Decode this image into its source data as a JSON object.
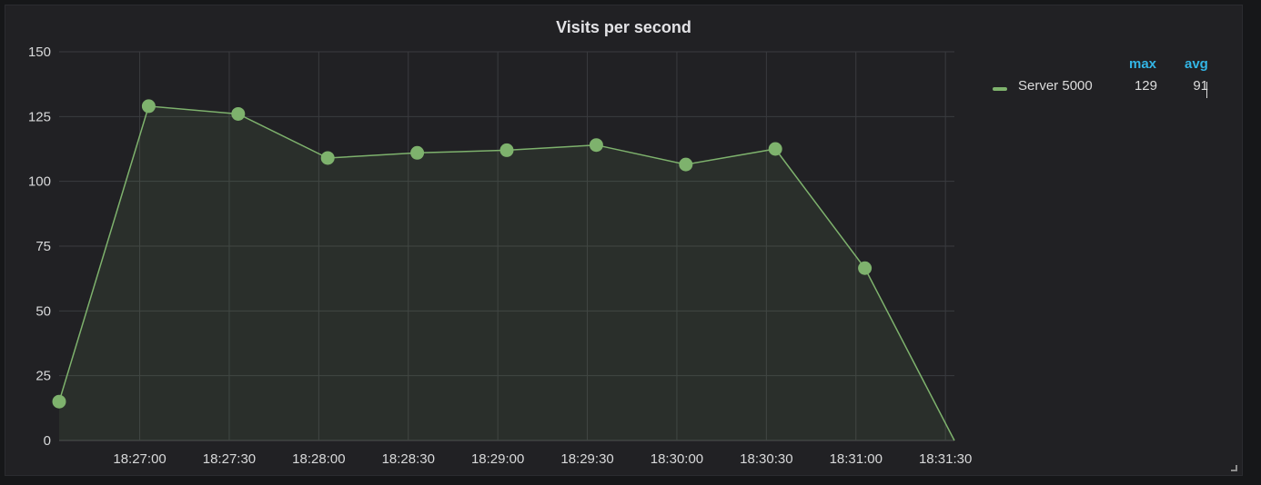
{
  "panel": {
    "title": "Visits per second"
  },
  "legend": {
    "columns": {
      "max": "max",
      "avg": "avg"
    },
    "series": [
      {
        "name": "Server 5000",
        "color": "#7eb26d",
        "max": "129",
        "avg": "91"
      }
    ]
  },
  "chart_data": {
    "type": "area",
    "title": "Visits per second",
    "xlabel": "",
    "ylabel": "",
    "ylim": [
      0,
      150
    ],
    "yticks": [
      0,
      25,
      50,
      75,
      100,
      125,
      150
    ],
    "xticks": [
      "18:27:00",
      "18:27:30",
      "18:28:00",
      "18:28:30",
      "18:29:00",
      "18:29:30",
      "18:30:00",
      "18:30:30",
      "18:31:00",
      "18:31:30"
    ],
    "xlim": [
      "18:26:33",
      "18:31:33"
    ],
    "grid": true,
    "legend_position": "right",
    "series": [
      {
        "name": "Server 5000",
        "color": "#7eb26d",
        "x": [
          "18:26:33",
          "18:27:03",
          "18:27:33",
          "18:28:03",
          "18:28:33",
          "18:29:03",
          "18:29:33",
          "18:30:03",
          "18:30:33",
          "18:31:03",
          "18:31:33"
        ],
        "values": [
          15,
          129,
          126,
          109,
          111,
          112,
          114,
          106.5,
          112.5,
          66.5,
          0
        ]
      }
    ]
  }
}
